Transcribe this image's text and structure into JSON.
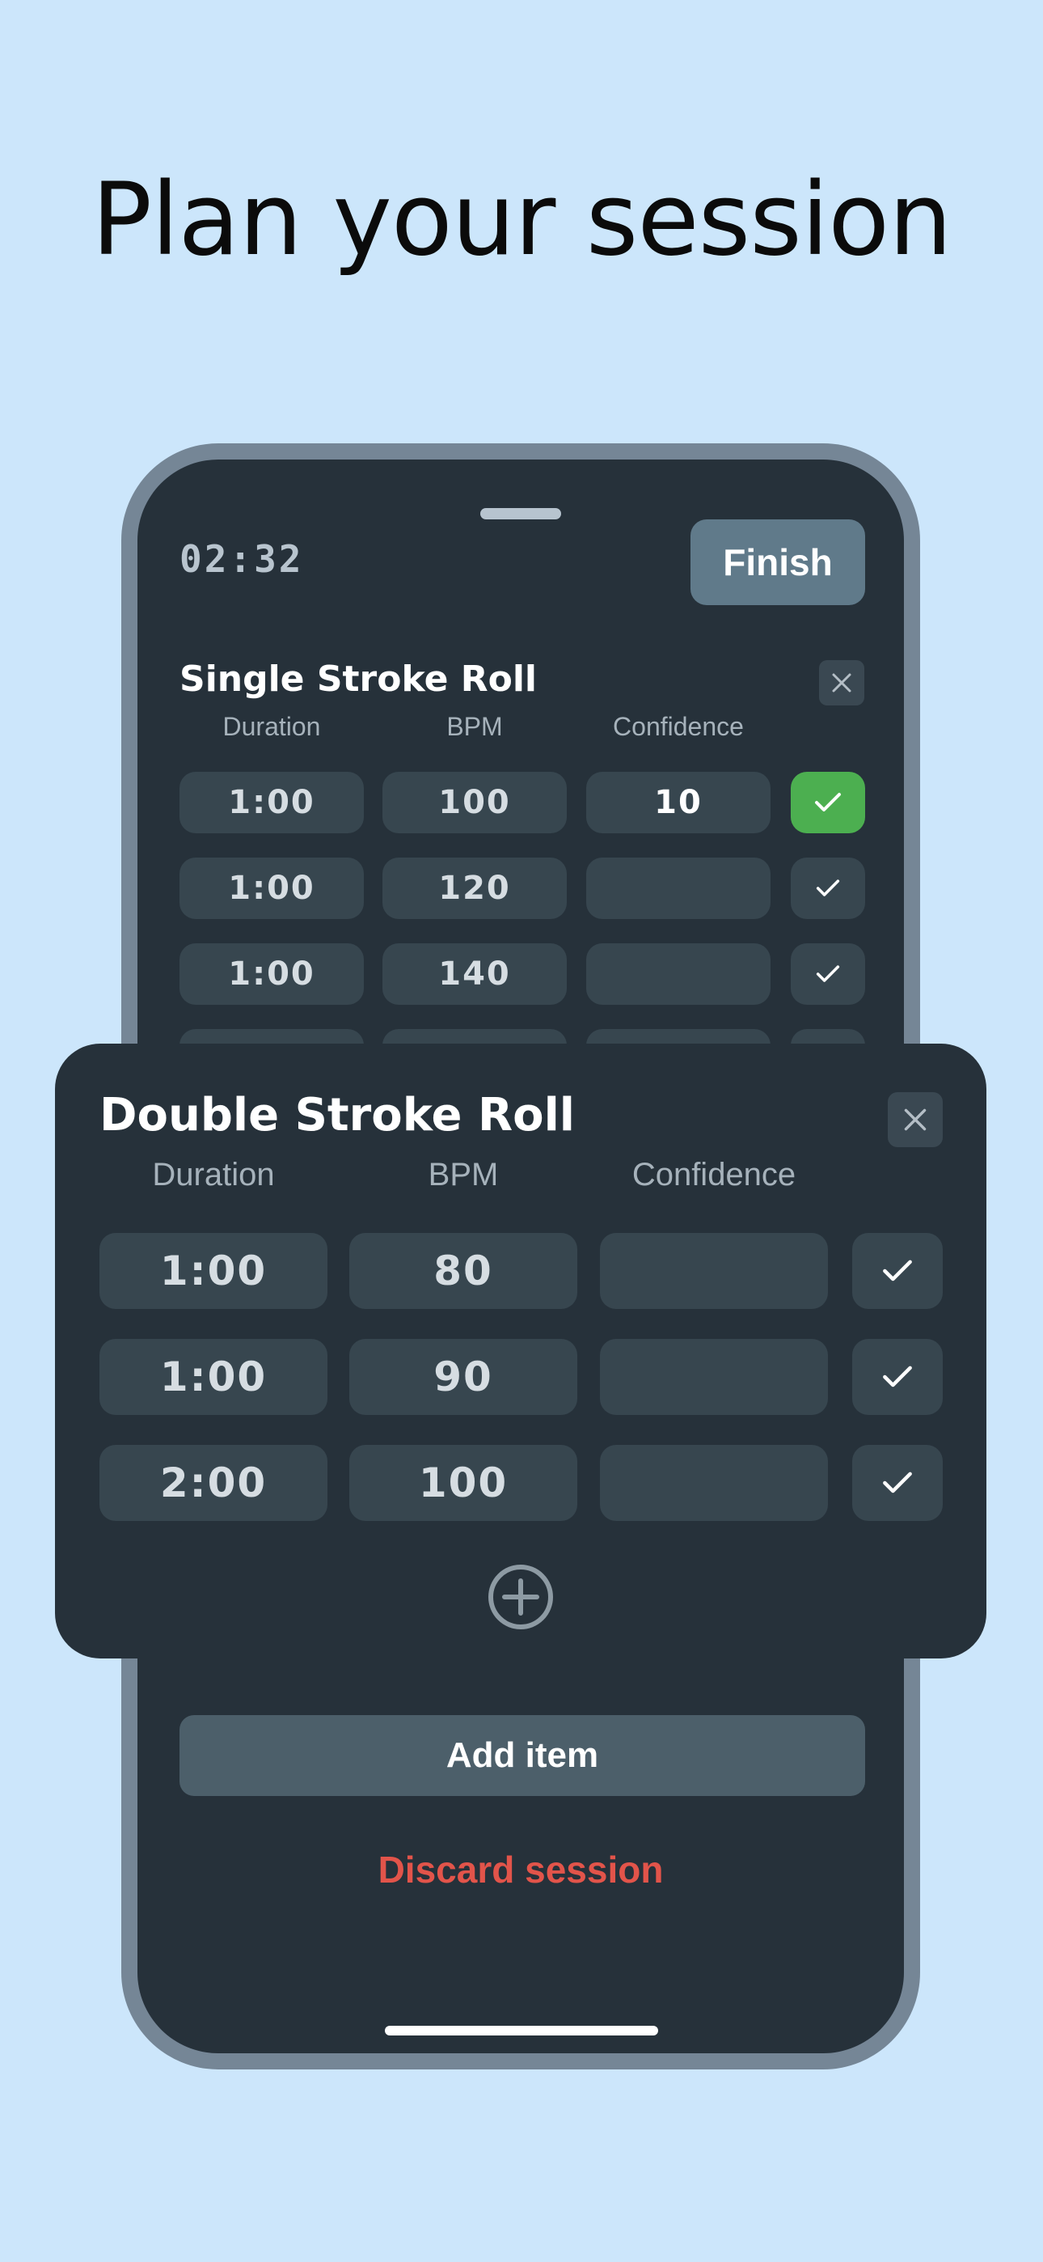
{
  "headline": "Plan your session",
  "session": {
    "timer": "02:32",
    "finish_label": "Finish",
    "add_item_label": "Add item",
    "discard_label": "Discard session"
  },
  "columns": {
    "duration": "Duration",
    "bpm": "BPM",
    "confidence": "Confidence"
  },
  "exercise1": {
    "title": "Single Stroke Roll",
    "rows": [
      {
        "duration": "1:00",
        "bpm": "100",
        "confidence": "10",
        "done": true
      },
      {
        "duration": "1:00",
        "bpm": "120",
        "confidence": "",
        "done": false
      },
      {
        "duration": "1:00",
        "bpm": "140",
        "confidence": "",
        "done": false
      }
    ]
  },
  "exercise2": {
    "title": "Double Stroke Roll",
    "rows": [
      {
        "duration": "1:00",
        "bpm": "80",
        "confidence": "",
        "done": false
      },
      {
        "duration": "1:00",
        "bpm": "90",
        "confidence": "",
        "done": false
      },
      {
        "duration": "2:00",
        "bpm": "100",
        "confidence": "",
        "done": false
      }
    ]
  },
  "icons": {
    "close": "close-icon",
    "check": "checkmark-icon",
    "add": "plus-circle-icon"
  },
  "colors": {
    "background": "#cce6fb",
    "card": "#26313a",
    "done_green": "#4caf50",
    "discard_red": "#e2544a"
  }
}
